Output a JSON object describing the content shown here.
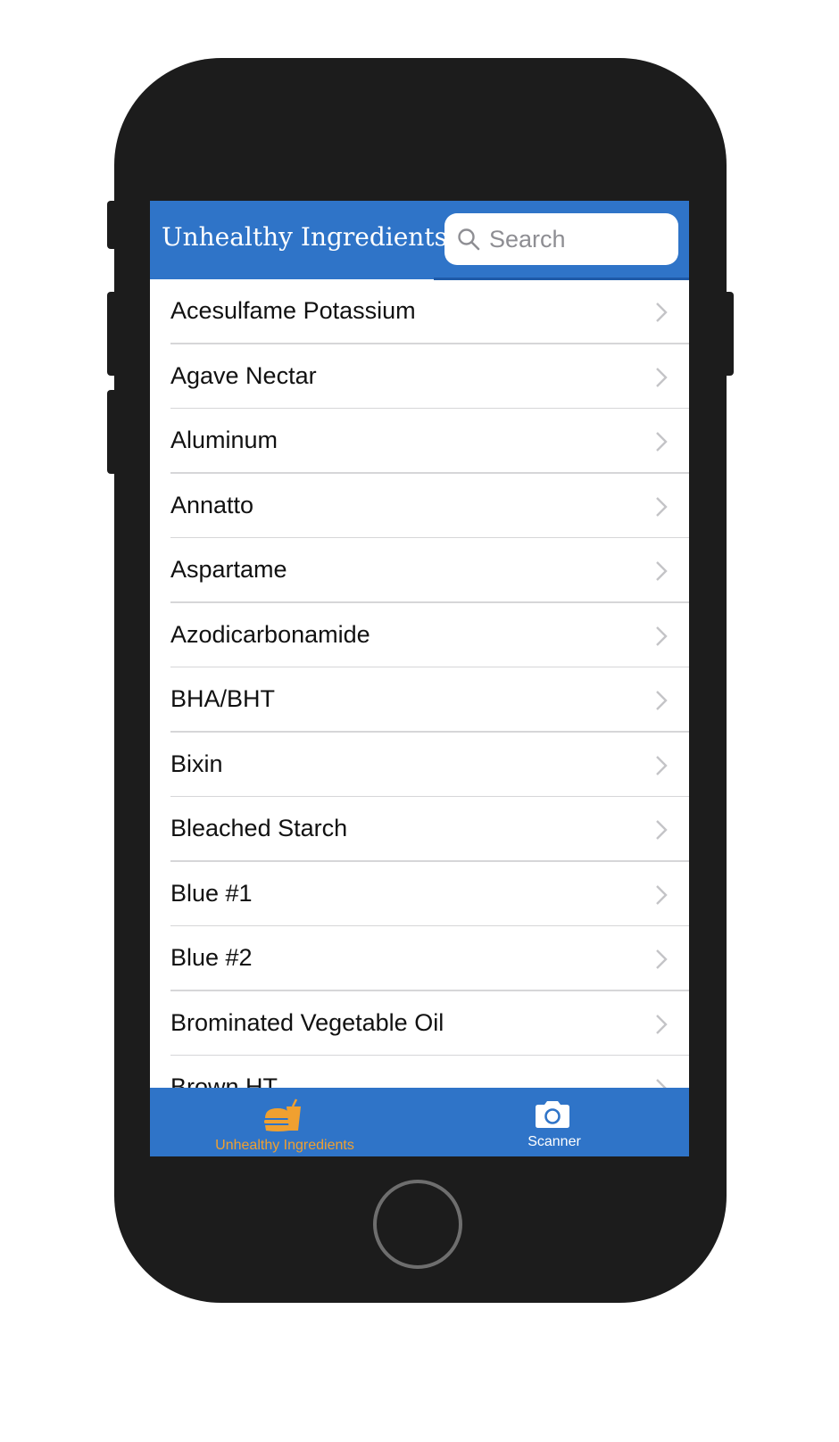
{
  "colors": {
    "accent": "#2f74c8",
    "active_tab": "#f0a030",
    "phone_body": "#1c1c1c"
  },
  "nav": {
    "title": "Unhealthy Ingredients",
    "search_placeholder": "Search",
    "search_value": ""
  },
  "list": {
    "items": [
      "Acesulfame Potassium",
      "Agave Nectar",
      "Aluminum",
      "Annatto",
      "Aspartame",
      "Azodicarbonamide",
      "BHA/BHT",
      "Bixin",
      "Bleached Starch",
      "Blue #1",
      "Blue #2",
      "Brominated Vegetable Oil",
      "Brown HT"
    ]
  },
  "tabbar": {
    "tabs": [
      {
        "label": "Unhealthy Ingredients",
        "icon": "food-icon",
        "selected": true
      },
      {
        "label": "Scanner",
        "icon": "camera-icon",
        "selected": false
      }
    ]
  }
}
